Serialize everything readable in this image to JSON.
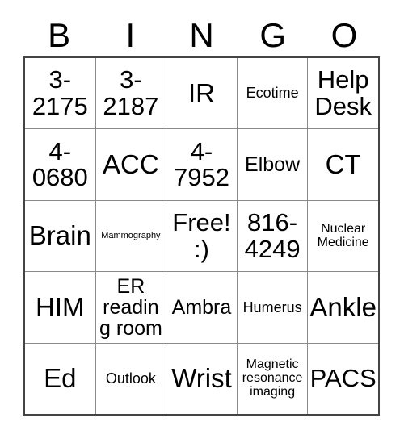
{
  "header": {
    "letters": [
      "B",
      "I",
      "N",
      "G",
      "O"
    ]
  },
  "grid": {
    "rows": [
      [
        {
          "text": "3-2175",
          "size": "fs-lg"
        },
        {
          "text": "3-2187",
          "size": "fs-lg"
        },
        {
          "text": "IR",
          "size": "fs-xl"
        },
        {
          "text": "Ecotime",
          "size": "fs-sm"
        },
        {
          "text": "Help Desk",
          "size": "fs-lg"
        }
      ],
      [
        {
          "text": "4-0680",
          "size": "fs-lg"
        },
        {
          "text": "ACC",
          "size": "fs-xl"
        },
        {
          "text": "4-7952",
          "size": "fs-lg"
        },
        {
          "text": "Elbow",
          "size": "fs-md"
        },
        {
          "text": "CT",
          "size": "fs-xl"
        }
      ],
      [
        {
          "text": "Brain",
          "size": "fs-xl"
        },
        {
          "text": "Mammography",
          "size": "fs-xxs"
        },
        {
          "text": "Free! :)",
          "size": "fs-lg"
        },
        {
          "text": "816-4249",
          "size": "fs-lg"
        },
        {
          "text": "Nuclear Medicine",
          "size": "fs-xs"
        }
      ],
      [
        {
          "text": "HIM",
          "size": "fs-xl"
        },
        {
          "text": "ER reading room",
          "size": "fs-md"
        },
        {
          "text": "Ambra",
          "size": "fs-md"
        },
        {
          "text": "Humerus",
          "size": "fs-sm"
        },
        {
          "text": "Ankle",
          "size": "fs-xl"
        }
      ],
      [
        {
          "text": "Ed",
          "size": "fs-xl"
        },
        {
          "text": "Outlook",
          "size": "fs-sm"
        },
        {
          "text": "Wrist",
          "size": "fs-xl"
        },
        {
          "text": "Magnetic resonance imaging",
          "size": "fs-xs"
        },
        {
          "text": "PACS",
          "size": "fs-lg"
        }
      ]
    ]
  }
}
